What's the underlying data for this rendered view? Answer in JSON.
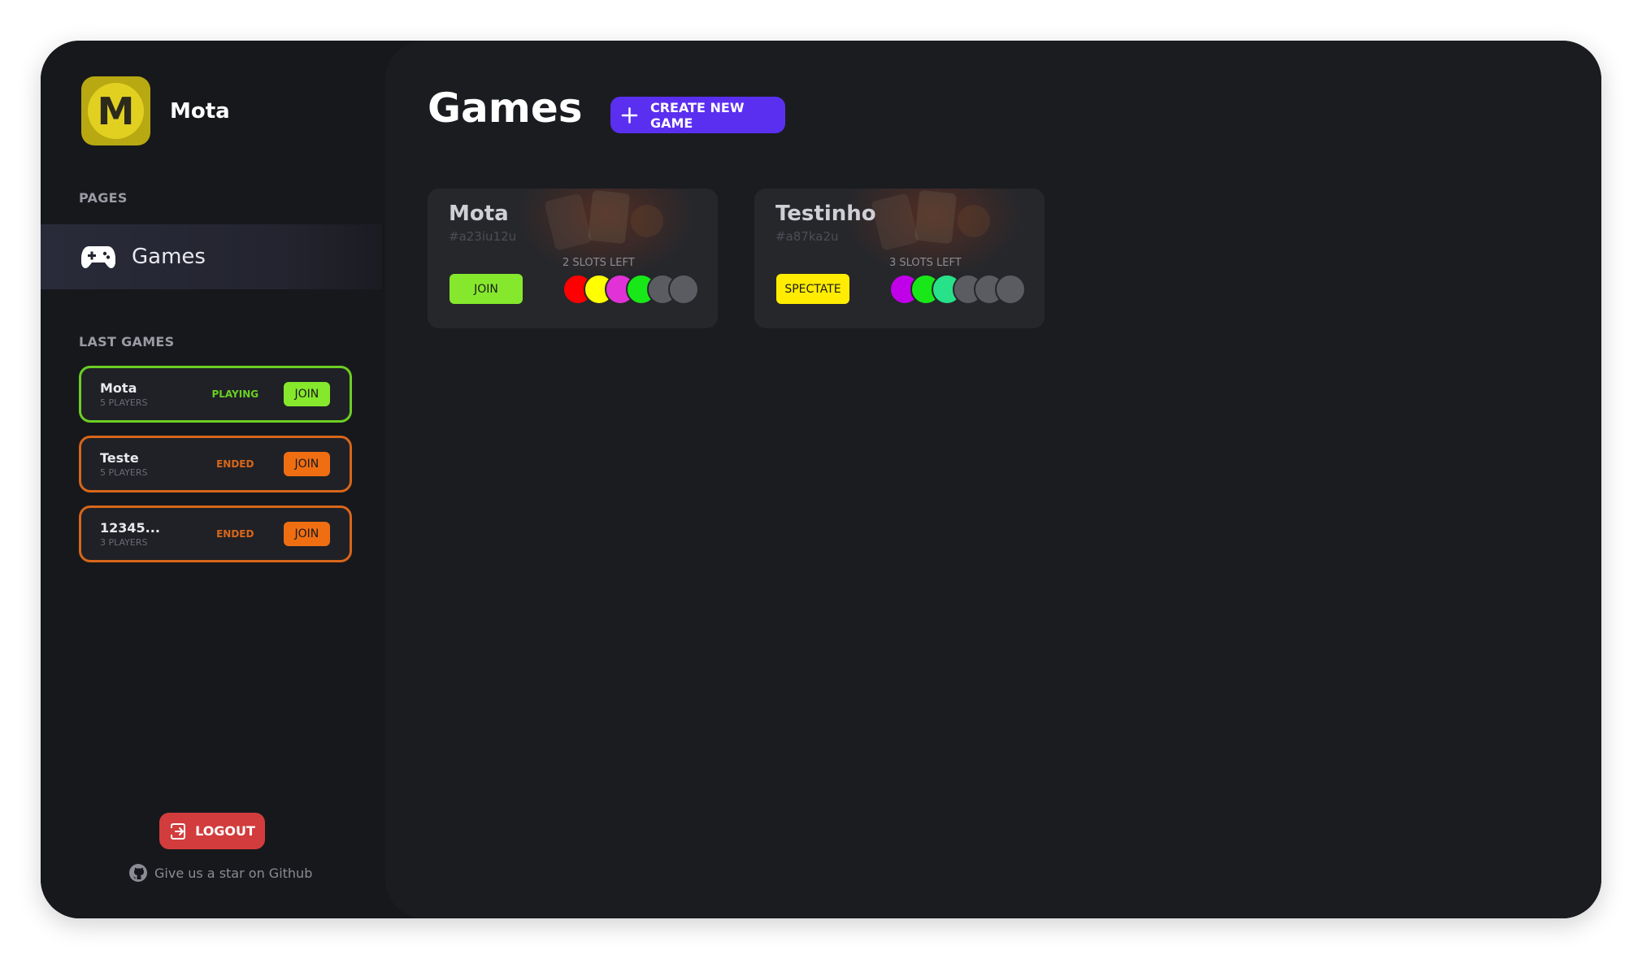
{
  "user": {
    "initial": "M",
    "name": "Mota"
  },
  "sidebar": {
    "pages_label": "PAGES",
    "nav": [
      {
        "label": "Games",
        "icon": "gamepad-icon"
      }
    ],
    "last_games_label": "LAST GAMES",
    "last_games": [
      {
        "name": "Mota",
        "players": "5 PLAYERS",
        "status": "PLAYING",
        "join": "JOIN",
        "color": "#6bcf23",
        "btn_color": "#86e82c"
      },
      {
        "name": "Teste",
        "players": "5 PLAYERS",
        "status": "ENDED",
        "join": "JOIN",
        "color": "#d8661a",
        "btn_color": "#f06e12"
      },
      {
        "name": "12345...",
        "players": "3 PLAYERS",
        "status": "ENDED",
        "join": "JOIN",
        "color": "#d8661a",
        "btn_color": "#f06e12"
      }
    ],
    "logout": "LOGOUT",
    "github": "Give us a star on Github"
  },
  "main": {
    "title": "Games",
    "create_button": "CREATE NEW GAME",
    "cards": [
      {
        "title": "Mota",
        "id": "#a23iu12u",
        "slots_left": "2 SLOTS LEFT",
        "button": "JOIN",
        "button_color": "#86e82c",
        "slots": [
          "#ff0000",
          "#ffff00",
          "#e032d6",
          "#18e818",
          "#5b5c61",
          "#5b5c61"
        ]
      },
      {
        "title": "Testinho",
        "id": "#a87ka2u",
        "slots_left": "3 SLOTS LEFT",
        "button": "SPECTATE",
        "button_color": "#ffec00",
        "slots": [
          "#c000e8",
          "#18e818",
          "#28e28a",
          "#5b5c61",
          "#5b5c61",
          "#5b5c61"
        ]
      }
    ]
  }
}
